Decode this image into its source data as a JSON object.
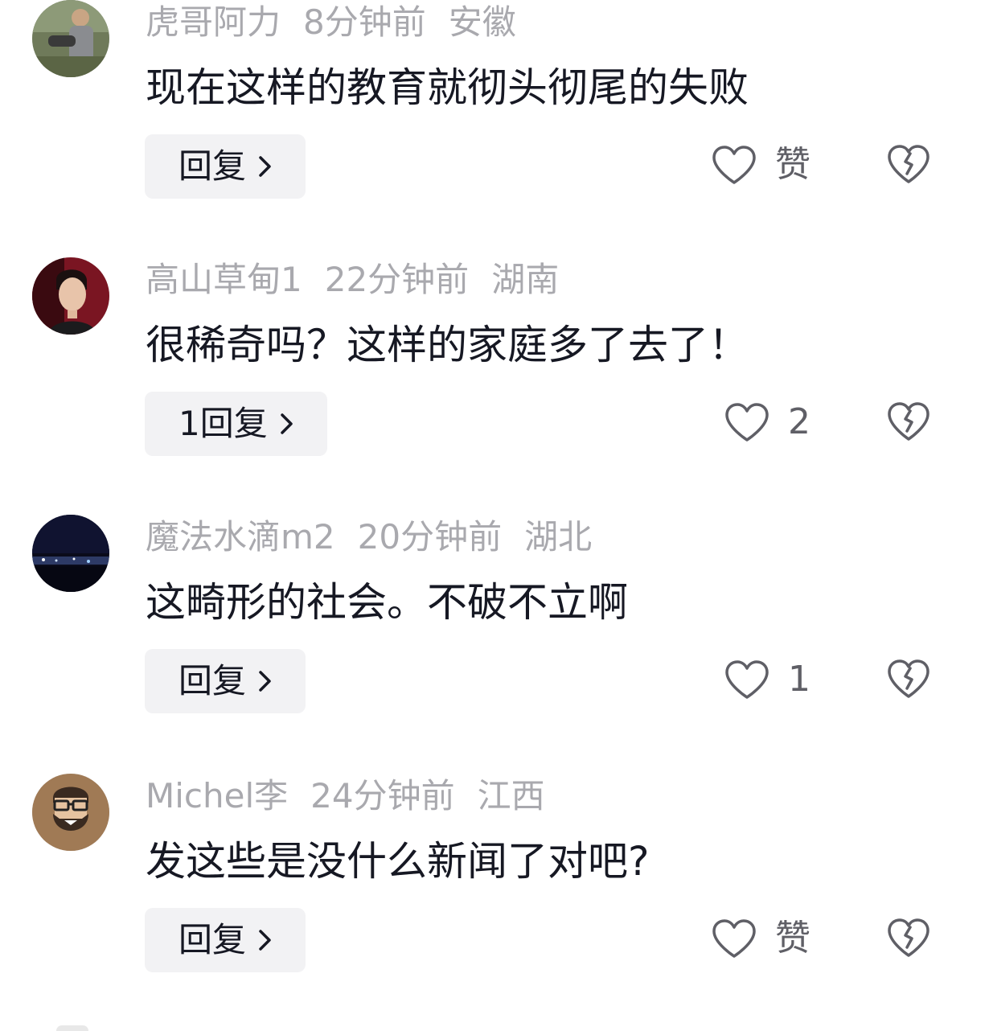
{
  "comments": [
    {
      "username": "虎哥阿力",
      "time": "8分钟前",
      "location": "安徽",
      "text": "现在这样的教育就彻头彻尾的失败",
      "reply_label": "回复",
      "like_label": "赞",
      "avatar_icon": "avatar-photo-man-outdoors"
    },
    {
      "username": "高山草甸1",
      "time": "22分钟前",
      "location": "湖南",
      "text": "很稀奇吗？这样的家庭多了去了！",
      "reply_label": "1回复",
      "like_label": "2",
      "avatar_icon": "avatar-photo-man-portrait"
    },
    {
      "username": "魔法水滴m2",
      "time": "20分钟前",
      "location": "湖北",
      "text": "这畸形的社会。不破不立啊",
      "reply_label": "回复",
      "like_label": "1",
      "avatar_icon": "avatar-photo-night-city"
    },
    {
      "username": "Michel李",
      "time": "24分钟前",
      "location": "江西",
      "text": "发这些是没什么新闻了对吧?",
      "reply_label": "回复",
      "like_label": "赞",
      "avatar_icon": "avatar-cartoon-bearded-man"
    }
  ],
  "colors": {
    "meta_text": "#a9a9ae",
    "body_text": "#161823",
    "reply_bg": "#f2f2f4",
    "icon_stroke": "#5f5f66"
  }
}
